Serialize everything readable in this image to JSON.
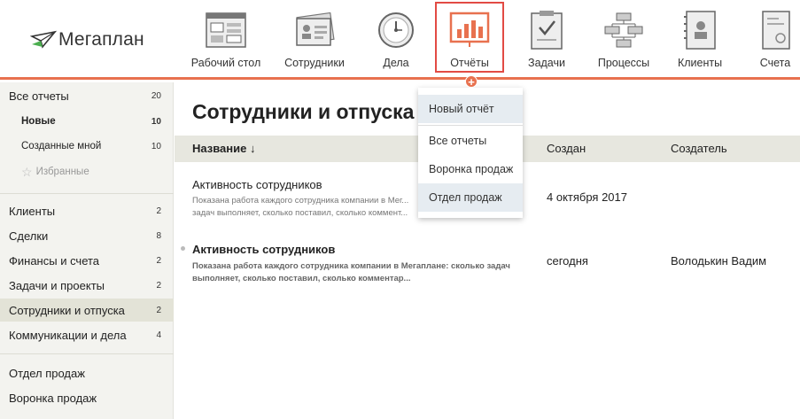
{
  "app": {
    "logo": "Мегаплан"
  },
  "nav": [
    {
      "label": "Рабочий стол",
      "icon": "dashboard-icon"
    },
    {
      "label": "Сотрудники",
      "icon": "employees-icon"
    },
    {
      "label": "Дела",
      "icon": "clock-icon"
    },
    {
      "label": "Отчёты",
      "icon": "reports-chart-icon",
      "active": true
    },
    {
      "label": "Задачи",
      "icon": "tasks-clipboard-icon"
    },
    {
      "label": "Процессы",
      "icon": "processes-flow-icon"
    },
    {
      "label": "Клиенты",
      "icon": "clients-book-icon"
    },
    {
      "label": "Счета",
      "icon": "invoice-icon"
    }
  ],
  "sidebar": {
    "all_reports": {
      "label": "Все отчеты",
      "count": "20"
    },
    "new": {
      "label": "Новые",
      "count": "10"
    },
    "created_by_me": {
      "label": "Созданные мной",
      "count": "10"
    },
    "favorites": {
      "label": "Избранные"
    },
    "categories": [
      {
        "label": "Клиенты",
        "count": "2"
      },
      {
        "label": "Сделки",
        "count": "8"
      },
      {
        "label": "Финансы и счета",
        "count": "2"
      },
      {
        "label": "Задачи и проекты",
        "count": "2"
      },
      {
        "label": "Сотрудники и отпуска",
        "count": "2",
        "selected": true
      },
      {
        "label": "Коммуникации и дела",
        "count": "4"
      }
    ],
    "custom": [
      {
        "label": "Отдел продаж"
      },
      {
        "label": "Воронка продаж"
      }
    ]
  },
  "main": {
    "title": "Сотрудники и отпуска",
    "columns": {
      "name": "Название ↓",
      "created": "Создан",
      "creator": "Создатель"
    },
    "rows": [
      {
        "title": "Активность сотрудников",
        "desc": "Показана работа каждого сотрудника компании в Мег... задач выполняет, сколько поставил, сколько коммент...",
        "created": "4 октября 2017",
        "creator": "",
        "bold": false
      },
      {
        "title": "Активность сотрудников",
        "desc": "Показана работа каждого сотрудника компании в Мегаплане: сколько задач выполняет, сколько поставил, сколько комментар...",
        "created": "сегодня",
        "creator": "Володькин Вадим",
        "bold": true
      }
    ]
  },
  "dropdown": {
    "items": [
      "Новый отчёт",
      "Все отчеты",
      "Воронка продаж",
      "Отдел продаж"
    ]
  },
  "colors": {
    "accent": "#e8714f",
    "active_border": "#e24b44",
    "sidebar_bg": "#f3f3ef"
  }
}
